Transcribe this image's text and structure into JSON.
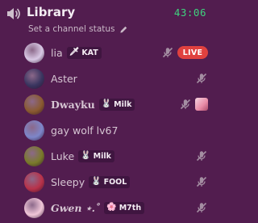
{
  "channel": {
    "name": "Library",
    "timer": "43:06",
    "status_placeholder": "Set a channel status",
    "icons": {
      "channel": "speaker-icon",
      "edit": "pencil-icon"
    }
  },
  "members": [
    {
      "name": "lia",
      "style": "normal",
      "tag": {
        "icon": "sword-icon",
        "glyph": "🗡",
        "label": "KAT"
      },
      "muted": true,
      "live": true,
      "live_label": "LIVE",
      "avatar_color": "#d8c8e4"
    },
    {
      "name": "Aster",
      "style": "normal",
      "tag": null,
      "muted": true,
      "live": false,
      "avatar_color": "#3a3560"
    },
    {
      "name": "Dwayku",
      "style": "fancy",
      "tag": {
        "icon": "bunny-icon",
        "glyph": "🐰",
        "label": "Milk"
      },
      "muted": true,
      "live": false,
      "stream_thumb": true,
      "avatar_color": "#8a5a30"
    },
    {
      "name": "gay wolf lv67",
      "style": "normal",
      "tag": null,
      "muted": false,
      "live": false,
      "avatar_color": "#7d86c9"
    },
    {
      "name": "Luke",
      "style": "normal",
      "tag": {
        "icon": "bunny-icon",
        "glyph": "🐰",
        "label": "Milk"
      },
      "muted": true,
      "live": false,
      "avatar_color": "#7a7a2a"
    },
    {
      "name": "Sleepy",
      "style": "normal",
      "tag": {
        "icon": "bunny-icon",
        "glyph": "🐰",
        "label": "FOOL"
      },
      "muted": true,
      "live": false,
      "avatar_color": "#b8324a"
    },
    {
      "name": "Gwen ⋆.˚",
      "style": "italic",
      "tag": {
        "icon": "flower-icon",
        "glyph": "🌸",
        "label": "M7th"
      },
      "muted": true,
      "live": false,
      "avatar_color": "#f0c6d8"
    }
  ],
  "colors": {
    "background": "#521d4f",
    "timer": "#3fd27e",
    "live": "#e0413f"
  }
}
